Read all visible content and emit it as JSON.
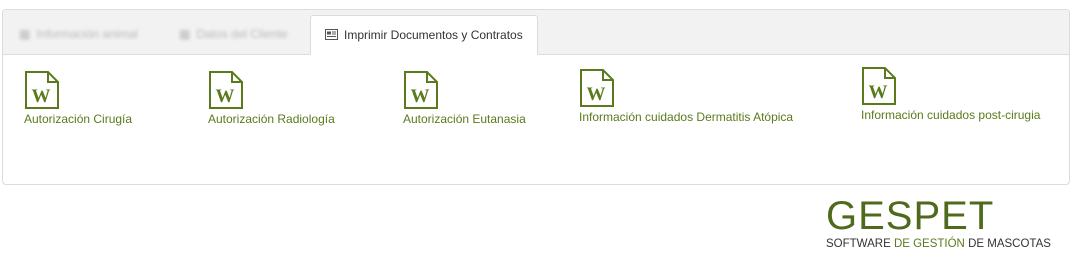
{
  "tabs": [
    {
      "label": "Información animal",
      "active": false,
      "blurred": true
    },
    {
      "label": "Datos del Cliente",
      "active": false,
      "blurred": true
    },
    {
      "label": "Imprimir Documentos y Contratos",
      "active": true,
      "blurred": false
    }
  ],
  "documents": [
    {
      "label": "Autorización Cirugía",
      "icon": "word-document-icon"
    },
    {
      "label": "Autorización Radiología",
      "icon": "word-document-icon"
    },
    {
      "label": "Autorización Eutanasia",
      "icon": "word-document-icon"
    },
    {
      "label": "Información cuidados Dermatitis Atópica",
      "icon": "word-document-icon"
    },
    {
      "label": "Información cuidados post-cirugia",
      "icon": "word-document-icon"
    }
  ],
  "logo": {
    "brand": "GESPET",
    "tagline_part1": "SOFTWARE ",
    "tagline_part2": "DE GESTIÓN",
    "tagline_part3": " DE MASCOTAS"
  },
  "colors": {
    "accent": "#5a7a1c",
    "brand": "#4f6a1c",
    "tabbar_bg": "#f2f2f2"
  }
}
